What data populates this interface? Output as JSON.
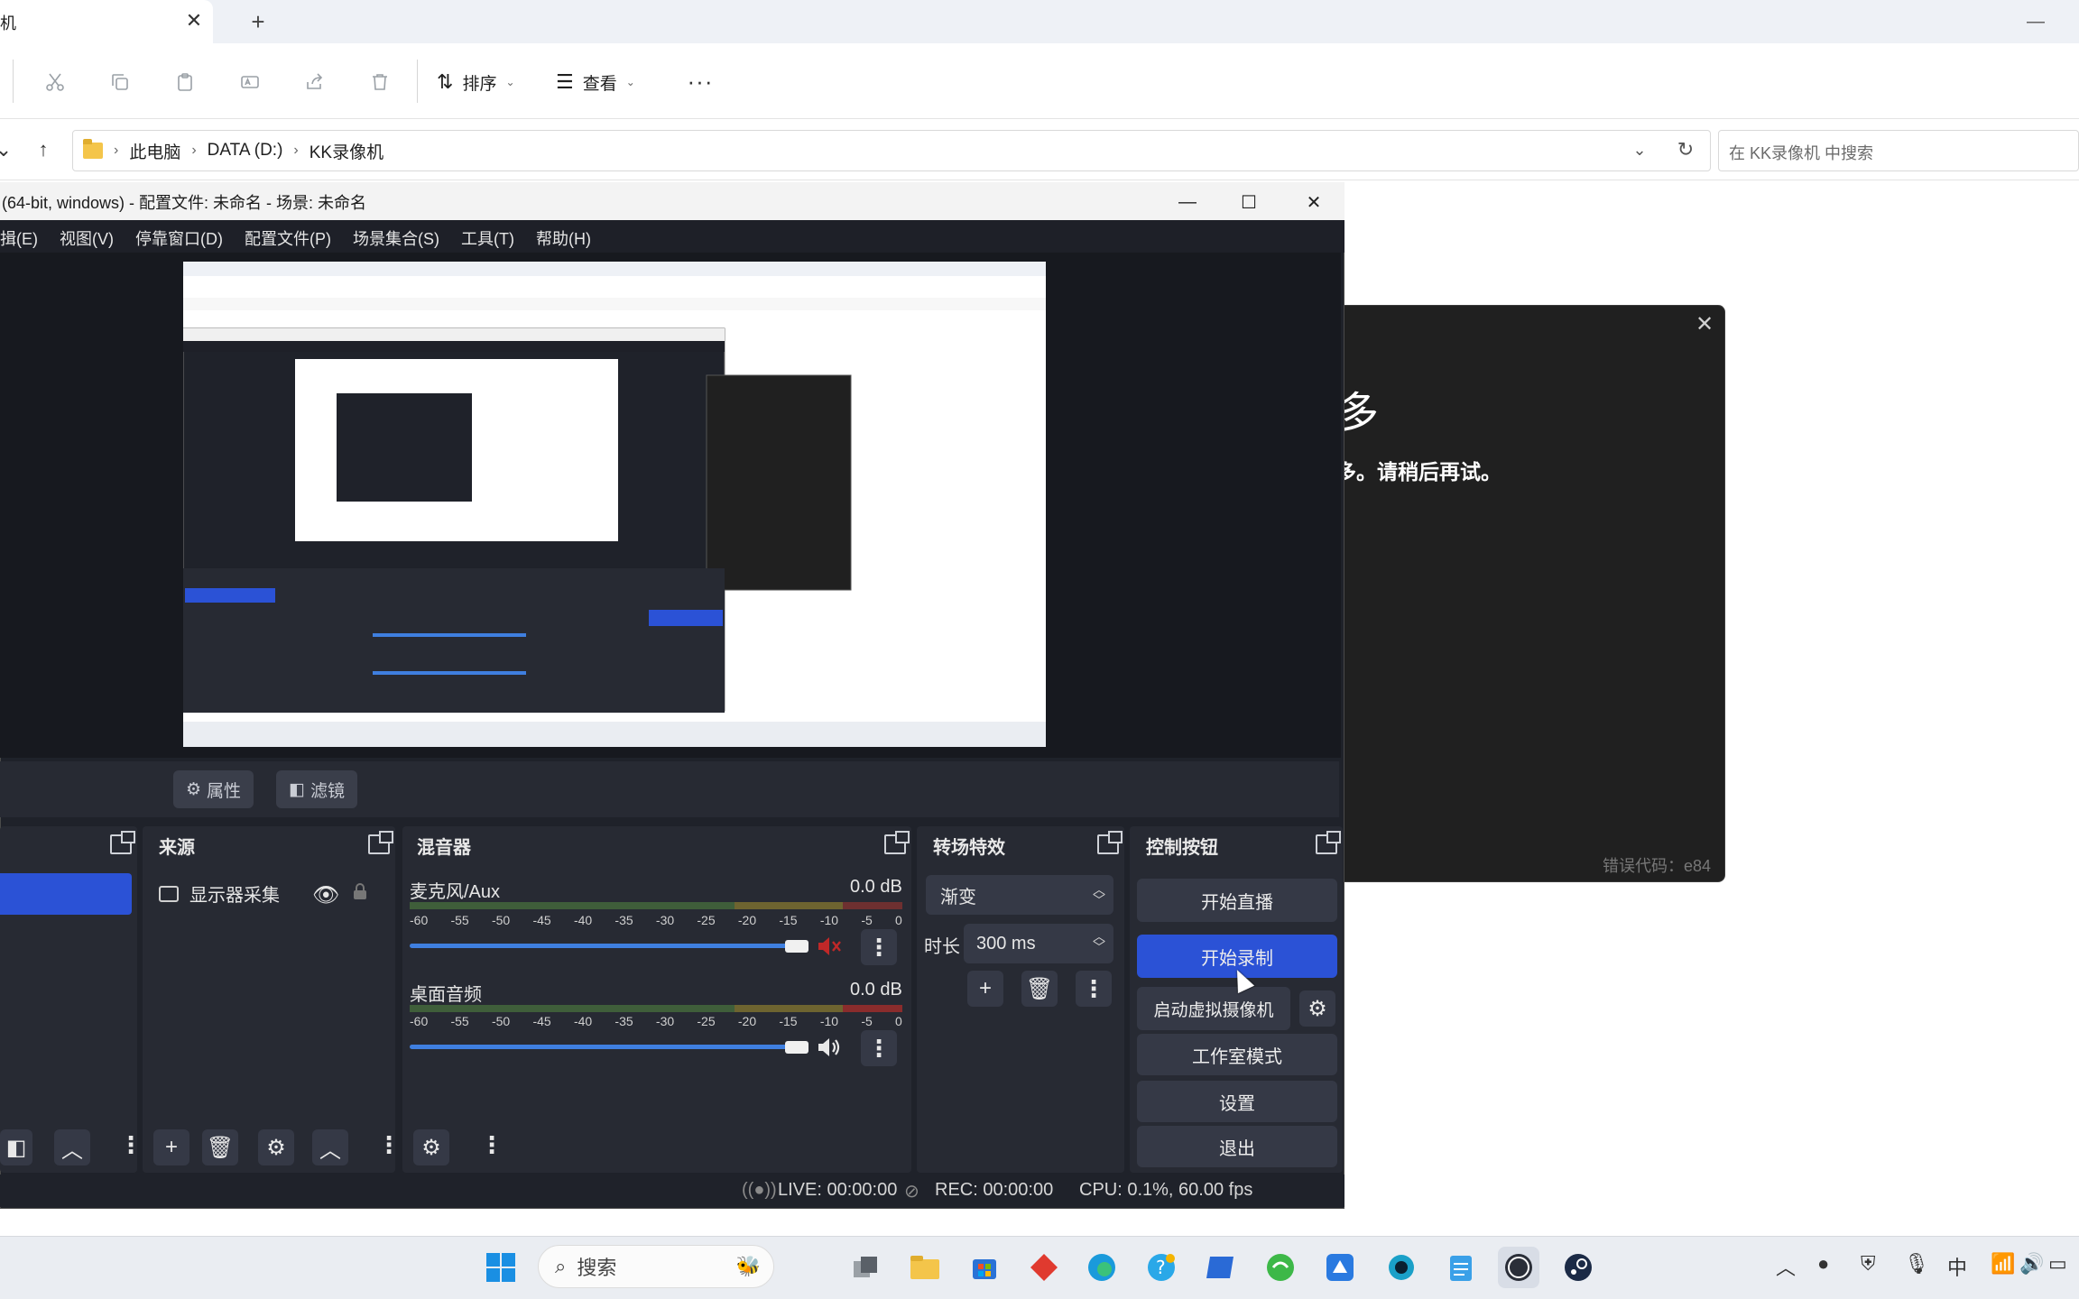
{
  "explorer": {
    "tab_title": "机",
    "tab_close": "✕",
    "new_tab": "+",
    "toolbar": {
      "sort_label": "排序",
      "view_label": "查看",
      "more_label": "···"
    },
    "breadcrumb": [
      "此电脑",
      "DATA (D:)",
      "KK录像机"
    ],
    "search_placeholder": "在 KK录像机 中搜索"
  },
  "error_dialog": {
    "title_fragment": "多",
    "message": "多。请稍后再试。",
    "error_code": "错误代码：e84"
  },
  "obs": {
    "title": "(64-bit, windows) - 配置文件: 未命名 - 场景: 未命名",
    "menu": [
      "揖(E)",
      "视图(V)",
      "停靠窗口(D)",
      "配置文件(P)",
      "场景集合(S)",
      "工具(T)",
      "帮助(H)"
    ],
    "source_toolbar": {
      "properties": "属性",
      "filters": "滤镜"
    },
    "docks": {
      "sources": {
        "title": "来源",
        "item": "显示器采集"
      },
      "mixer": {
        "title": "混音器",
        "channels": [
          {
            "name": "麦克风/Aux",
            "db": "0.0 dB",
            "volume": 0.98,
            "muted": true
          },
          {
            "name": "桌面音频",
            "db": "0.0 dB",
            "volume": 0.98,
            "muted": false
          }
        ],
        "scale": [
          "-60",
          "-55",
          "-50",
          "-45",
          "-40",
          "-35",
          "-30",
          "-25",
          "-20",
          "-15",
          "-10",
          "-5",
          "0"
        ]
      },
      "transitions": {
        "title": "转场特效",
        "selected": "渐变",
        "duration_label": "时长",
        "duration_value": "300 ms"
      },
      "controls": {
        "title": "控制按钮",
        "start_stream": "开始直播",
        "start_record": "开始录制",
        "start_virtualcam": "启动虚拟摄像机",
        "studio_mode": "工作室模式",
        "settings": "设置",
        "exit": "退出"
      }
    },
    "status": {
      "live": "LIVE: 00:00:00",
      "rec": "REC: 00:00:00",
      "cpu": "CPU: 0.1%, 60.00 fps"
    }
  },
  "taskbar": {
    "search_label": "搜索",
    "input_method": "中"
  },
  "colors": {
    "obs_accent": "#2b52d6",
    "obs_bg": "#1f222a",
    "dock_bg": "#272a33",
    "muted_red": "#d02020"
  }
}
